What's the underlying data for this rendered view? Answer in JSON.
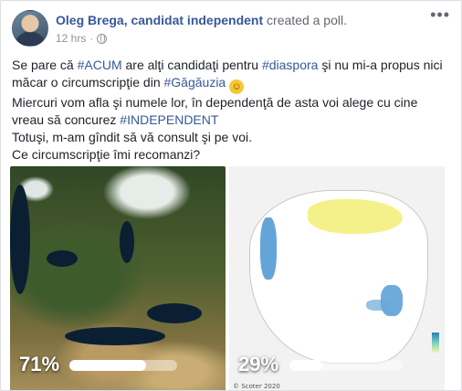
{
  "post": {
    "author": "Oleg Brega, candidat independent",
    "action": "created a poll.",
    "timestamp": "12 hrs",
    "privacy_icon": "globe-icon",
    "more_icon": "more-horizontal-icon",
    "text": {
      "l1_a": "Se pare că ",
      "l1_tag1": "#ACUM",
      "l1_b": " are alţi candidaţi pentru ",
      "l1_tag2": "#diaspora",
      "l1_c": " şi nu mi-a propus nici",
      "l2_a": "măcar o circumscripţie din ",
      "l2_tag": "#Găgăuzia",
      "emoji": "☺",
      "l3": "Miercuri vom afla şi numele lor, în dependenţă de asta voi alege cu cine",
      "l4_a": "vreau să concurez ",
      "l4_tag": "#INDEPENDENT",
      "l5": "Totuşi, m-am gîndit să vă consult şi pe voi.",
      "l6": "Ce circumscripţie îmi recomanzi?"
    }
  },
  "poll": {
    "options": [
      {
        "image": "europe-satellite-map",
        "percent_label": "71%",
        "share": 0.71
      },
      {
        "image": "north-america-map",
        "percent_label": "29%",
        "share": 0.29,
        "copyright": "© Scoter 2020"
      }
    ]
  },
  "colors": {
    "link": "#365899",
    "text": "#1d2129",
    "meta": "#90949c"
  }
}
